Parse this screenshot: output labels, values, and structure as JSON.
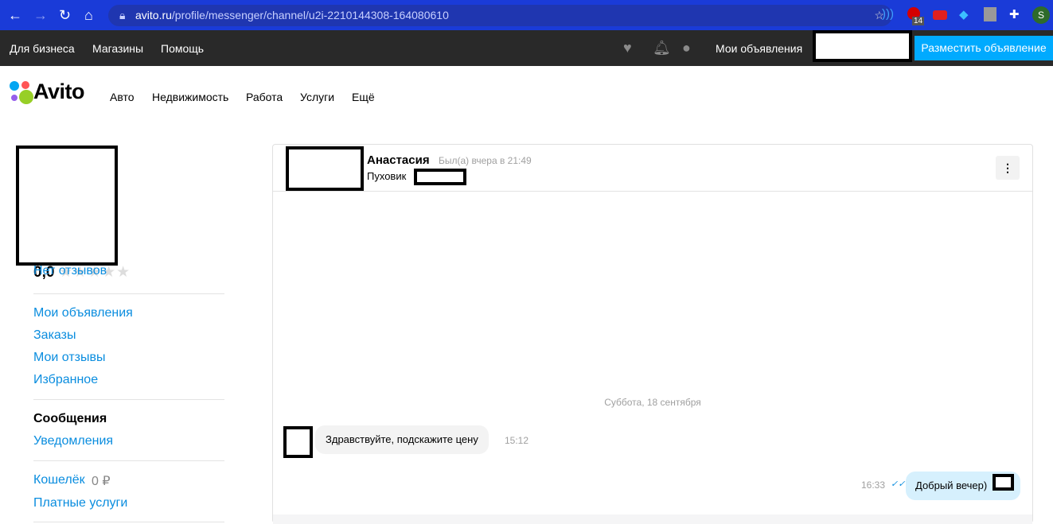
{
  "browser": {
    "url_domain": "avito.ru",
    "url_path": "/profile/messenger/channel/u2i-2210144308-164080610",
    "badge_count": "14",
    "profile_initial": "S"
  },
  "topbar": {
    "links": [
      "Для бизнеса",
      "Магазины",
      "Помощь"
    ],
    "my_ads": "Мои объявления",
    "post_button": "Разместить объявление"
  },
  "header": {
    "logo": "Avito",
    "categories": [
      "Авто",
      "Недвижимость",
      "Работа",
      "Услуги",
      "Ещё"
    ]
  },
  "sidebar": {
    "rating": "0,0",
    "reviews_link": "Нет отзывов",
    "group1": [
      "Мои объявления",
      "Заказы",
      "Мои отзывы",
      "Избранное"
    ],
    "messages": "Сообщения",
    "notifications": "Уведомления",
    "wallet": "Кошелёк",
    "wallet_balance": "0 ₽",
    "paid_services": "Платные услуги"
  },
  "chat": {
    "name": "Анастасия",
    "status": "Был(а) вчера в 21:49",
    "item": "Пуховик",
    "date": "Суббота, 18 сентября",
    "messages": [
      {
        "text": "Здравствуйте, подскажите цену",
        "time": "15:12"
      },
      {
        "text": "Добрый вечер)",
        "time": "16:33"
      }
    ]
  }
}
